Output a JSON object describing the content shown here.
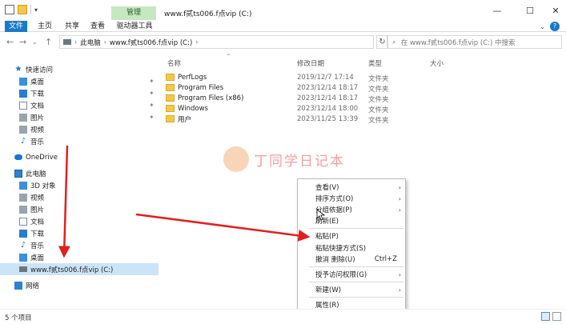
{
  "window": {
    "title": "www.f贰ts006.f点vip (C:)",
    "manage_tab": "管理",
    "minimize": "—",
    "maximize": "☐",
    "close": "✕"
  },
  "ribbon": {
    "tabs": [
      "文件",
      "主页",
      "共享",
      "查看",
      "驱动器工具"
    ]
  },
  "address": {
    "crumbs": [
      "此电脑",
      "www.f贰ts006.f点vip (C:)"
    ],
    "search_placeholder": "在 www.f贰ts006.f点vip (C:) 中搜索"
  },
  "sidebar": {
    "items": [
      {
        "label": "快速访问",
        "icon": "star-icon"
      },
      {
        "label": "桌面",
        "icon": "desktop-icon"
      },
      {
        "label": "下载",
        "icon": "download-icon"
      },
      {
        "label": "文档",
        "icon": "document-icon"
      },
      {
        "label": "图片",
        "icon": "pictures-icon"
      },
      {
        "label": "视频",
        "icon": "video-icon"
      },
      {
        "label": "音乐",
        "icon": "music-icon"
      },
      {
        "label": "OneDrive",
        "icon": "onedrive-icon"
      },
      {
        "label": "此电脑",
        "icon": "this-pc-icon"
      },
      {
        "label": "3D 对象",
        "icon": "3d-objects-icon"
      },
      {
        "label": "视频",
        "icon": "video-icon"
      },
      {
        "label": "图片",
        "icon": "pictures-icon"
      },
      {
        "label": "文档",
        "icon": "document-icon"
      },
      {
        "label": "下载",
        "icon": "download-icon"
      },
      {
        "label": "音乐",
        "icon": "music-icon"
      },
      {
        "label": "桌面",
        "icon": "desktop-icon"
      },
      {
        "label": "www.f贰ts006.f点vip (C:)",
        "icon": "drive-icon"
      },
      {
        "label": "网络",
        "icon": "network-icon"
      }
    ]
  },
  "columns": {
    "name": "名称",
    "date": "修改日期",
    "type": "类型",
    "size": "大小"
  },
  "files": [
    {
      "name": "PerfLogs",
      "date": "2019/12/7 17:14",
      "type": "文件夹"
    },
    {
      "name": "Program Files",
      "date": "2023/12/14 18:17",
      "type": "文件夹"
    },
    {
      "name": "Program Files (x86)",
      "date": "2023/12/14 18:17",
      "type": "文件夹"
    },
    {
      "name": "Windows",
      "date": "2023/12/14 18:00",
      "type": "文件夹"
    },
    {
      "name": "用户",
      "date": "2023/11/25 13:39",
      "type": "文件夹"
    }
  ],
  "watermark": "丁同学日记本",
  "context_menu": {
    "items": [
      {
        "label": "查看(V)",
        "arrow": "›"
      },
      {
        "label": "排序方式(O)",
        "arrow": "›"
      },
      {
        "label": "分组依据(P)",
        "arrow": "›"
      },
      {
        "label": "刷新(E)"
      },
      {
        "label": "粘贴(P)"
      },
      {
        "label": "粘贴快捷方式(S)"
      },
      {
        "label": "撤消 删除(U)",
        "shortcut": "Ctrl+Z"
      },
      {
        "label": "授予访问权限(G)",
        "arrow": "›"
      },
      {
        "label": "新建(W)",
        "arrow": "›"
      },
      {
        "label": "属性(R)"
      }
    ]
  },
  "status": {
    "count": "5 个项目"
  },
  "colors": {
    "accent": "#1979ca",
    "manage_tab_bg": "#c6e8c0",
    "selected_bg": "#cce4f7",
    "arrow_red": "#e02020"
  }
}
